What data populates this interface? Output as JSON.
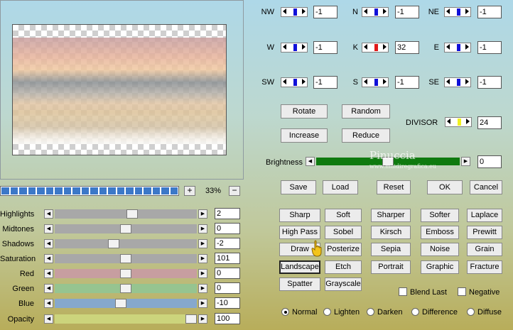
{
  "zoom": {
    "plus": "+",
    "minus": "−",
    "value": "33%"
  },
  "sliders": [
    {
      "label": "Highlights",
      "value": "2",
      "level": 0.55,
      "track": "#a8a8a8"
    },
    {
      "label": "Midtones",
      "value": "0",
      "level": 0.5,
      "track": "#a8a8a8"
    },
    {
      "label": "Shadows",
      "value": "-2",
      "level": 0.41,
      "track": "#a8a8a8"
    },
    {
      "label": "Saturation",
      "value": "101",
      "level": 0.5,
      "track": "#a8a8a8"
    },
    {
      "label": "Red",
      "value": "0",
      "level": 0.5,
      "track": "#c79ea0"
    },
    {
      "label": "Green",
      "value": "0",
      "level": 0.5,
      "track": "#96c490"
    },
    {
      "label": "Blue",
      "value": "-10",
      "level": 0.46,
      "track": "#86a8cc"
    },
    {
      "label": "Opacity",
      "value": "100",
      "level": 1.0,
      "track": "#ccd47c"
    }
  ],
  "matrix": [
    {
      "label": "NW",
      "value": "-1"
    },
    {
      "label": "N",
      "value": "-1"
    },
    {
      "label": "NE",
      "value": "-1"
    },
    {
      "label": "W",
      "value": "-1"
    },
    {
      "label": "K",
      "value": "32"
    },
    {
      "label": "E",
      "value": "-1"
    },
    {
      "label": "SW",
      "value": "-1"
    },
    {
      "label": "S",
      "value": "-1"
    },
    {
      "label": "SE",
      "value": "-1"
    }
  ],
  "divisor": {
    "label": "DIVISOR",
    "value": "24"
  },
  "brightness": {
    "label": "Brightness",
    "value": "0",
    "level": 0.5
  },
  "buttons": {
    "rotate": "Rotate",
    "random": "Random",
    "increase": "Increase",
    "reduce": "Reduce",
    "save": "Save",
    "load": "Load",
    "reset": "Reset",
    "ok": "OK",
    "cancel": "Cancel"
  },
  "presets": [
    [
      "Sharp",
      "Soft",
      "Sharper",
      "Softer",
      "Laplace"
    ],
    [
      "High Pass",
      "Sobel",
      "Kirsch",
      "Emboss",
      "Prewitt"
    ],
    [
      "Draw",
      "Posterize",
      "Sepia",
      "Noise",
      "Grain"
    ],
    [
      "Landscape",
      "Etch",
      "Portrait",
      "Graphic",
      "Fracture"
    ],
    [
      "Spatter",
      "Grayscale"
    ]
  ],
  "selected_preset": "Landscape",
  "checks": {
    "blend_last": "Blend Last",
    "negative": "Negative"
  },
  "blend_modes": [
    "Normal",
    "Lighten",
    "Darken",
    "Difference",
    "Diffuse"
  ],
  "selected_blend": "Normal",
  "watermark": {
    "title": "Pinuccia",
    "url": "www.maidiregrafica.eu"
  },
  "colors": {
    "accent": "#1010d8",
    "brightness_track": "#0f7a0f"
  }
}
